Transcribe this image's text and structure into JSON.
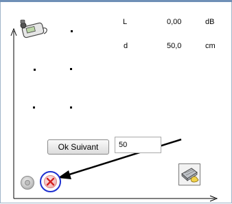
{
  "readouts": {
    "level": {
      "label": "L",
      "value": "0,00",
      "unit": "dB"
    },
    "distance": {
      "label": "d",
      "value": "50,0",
      "unit": "cm"
    }
  },
  "controls": {
    "ok_next_label": "Ok Suivant",
    "value_input": "50"
  },
  "icons": {
    "device": "sound-meter-icon",
    "record": "record-icon",
    "cancel": "cancel-x-icon",
    "tool": "keyboard-hand-icon",
    "pointer_arrow": "pointer-arrow-icon"
  },
  "colors": {
    "frame_border": "#9fb3c8",
    "highlight_circle": "#1d2fd0",
    "cancel_x": "#d42020"
  }
}
